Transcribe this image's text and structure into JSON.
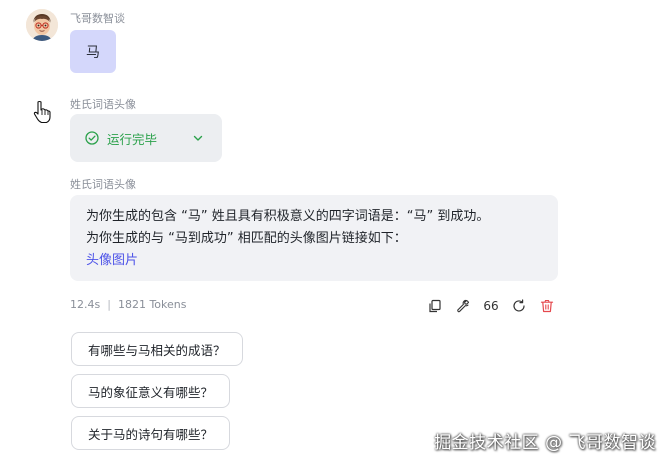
{
  "user": {
    "name": "飞哥数智谈",
    "message": "马"
  },
  "bot_run": {
    "name": "姓氏词语头像",
    "status_label": "运行完毕"
  },
  "bot_answer": {
    "name": "姓氏词语头像",
    "line1": "为你生成的包含 “马” 姓且具有积极意义的四字词语是：“马” 到成功。",
    "line2": "为你生成的与 “马到成功” 相匹配的头像图片链接如下：",
    "link_text": "头像图片"
  },
  "meta": {
    "duration": "12.4s",
    "separator": "|",
    "tokens": "1821 Tokens"
  },
  "actions": {
    "quote_label": "66",
    "icons": [
      "copy-icon",
      "wrench-icon",
      "quote-icon",
      "refresh-icon",
      "trash-icon"
    ],
    "trash_color": "#e5484d"
  },
  "suggestions": [
    "有哪些与马相关的成语？",
    "马的象征意义有哪些？",
    "关于马的诗句有哪些？"
  ],
  "watermark": "掘金技术社区 @ 飞哥数智谈",
  "colors": {
    "user_bubble": "#d4d7fb",
    "status_green": "#2ba14b",
    "link_blue": "#4d53e8"
  }
}
